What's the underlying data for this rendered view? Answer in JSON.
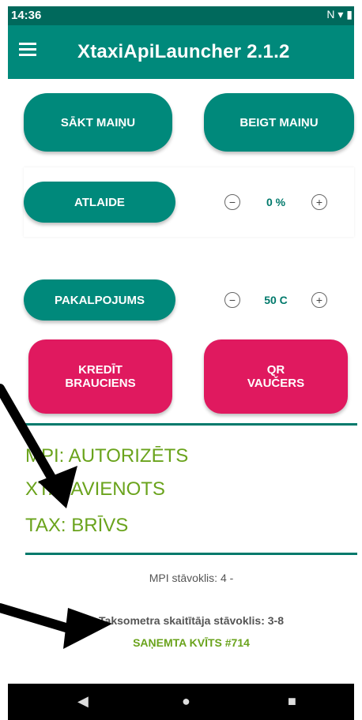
{
  "status_bar": {
    "time": "14:36",
    "icons": "N ▾ ▮"
  },
  "app_bar": {
    "title": "XtaxiApiLauncher 2.1.2"
  },
  "buttons": {
    "start_shift": "SĀKT MAIŅU",
    "end_shift": "BEIGT MAIŅU",
    "discount": "ATLAIDE",
    "service": "PAKALPOJUMS",
    "credit_ride_line1": "KREDĪT",
    "credit_ride_line2": "BRAUCIENS",
    "qr_line1": "QR",
    "qr_line2": "VAUČERS"
  },
  "steppers": {
    "discount_value": "0 %",
    "service_value": "50 C",
    "minus": "−",
    "plus": "+"
  },
  "status": {
    "mpi": "MPI: AUTORIZĒTS",
    "xt": "XT: SAVIENOTS",
    "tax": "TAX: BRĪVS"
  },
  "info": {
    "mpi_state": "MPI stāvoklis: 4 -",
    "meter_state": "Taksometra skaitītāja stāvoklis: 3-8",
    "receipt": "SAŅEMTA KVĪTS #714"
  },
  "colors": {
    "teal": "#00897b",
    "pink": "#e0195f",
    "green": "#6aa31c"
  }
}
